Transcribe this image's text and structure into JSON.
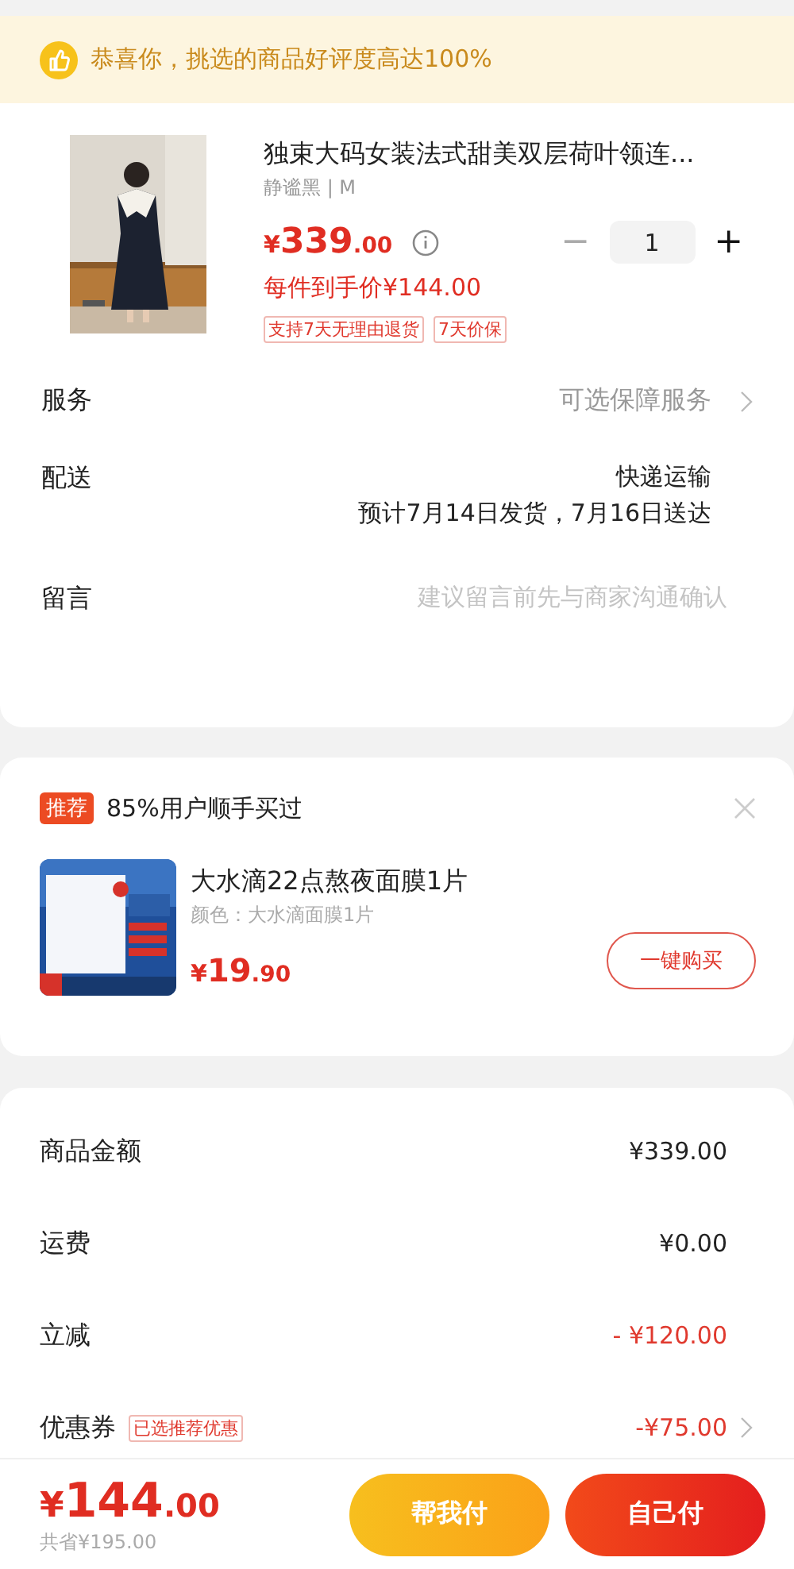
{
  "banner": {
    "text": "恭喜你，挑选的商品好评度高达100%"
  },
  "product": {
    "kind": "picture",
    "title": "独束大码女装法式甜美双层荷叶领连...",
    "variant": "静谧黑 | M",
    "price": {
      "currency": "¥",
      "integer": "339",
      "decimal": ".00"
    },
    "quantity": {
      "minus": "−",
      "value": "1",
      "plus": "+"
    },
    "final_price": "每件到手价¥144.00",
    "tags": [
      "支持7天无理由退货",
      "7天价保"
    ]
  },
  "rows": [
    {
      "label": "服务",
      "kind": "link",
      "value": "可选保障服务"
    },
    {
      "label": "配送",
      "kind": "shipping",
      "value": "快递运输",
      "detail": "预计7月14日发货，7月16日送达"
    },
    {
      "label": "留言",
      "kind": "input",
      "placeholder": "建议留言前先与商家沟通确认"
    }
  ],
  "recommend": {
    "badge": "推荐",
    "title": "85%用户顺手买过",
    "item": {
      "kind": "picture",
      "name": "大水滴22点熬夜面膜1片",
      "variant": "颜色：大水滴面膜1片",
      "price": {
        "currency": "¥",
        "integer": "19",
        "decimal": ".90"
      },
      "button": "一键购买"
    }
  },
  "summary": [
    {
      "label": "商品金额",
      "kind": "plain",
      "value": "¥339.00"
    },
    {
      "label": "运费",
      "kind": "plain",
      "value": "¥0.00"
    },
    {
      "label": "立减",
      "kind": "discount",
      "value": "- ¥120.00"
    },
    {
      "label": "优惠券",
      "kind": "coupon",
      "tag": "已选推荐优惠",
      "value": "-¥75.00"
    }
  ],
  "footer": {
    "total": {
      "currency": "¥",
      "integer": "144",
      "decimal": ".00"
    },
    "saved": "共省¥195.00",
    "buttons": [
      {
        "label": "帮我付",
        "kind": "friend"
      },
      {
        "label": "自己付",
        "kind": "self"
      }
    ]
  }
}
